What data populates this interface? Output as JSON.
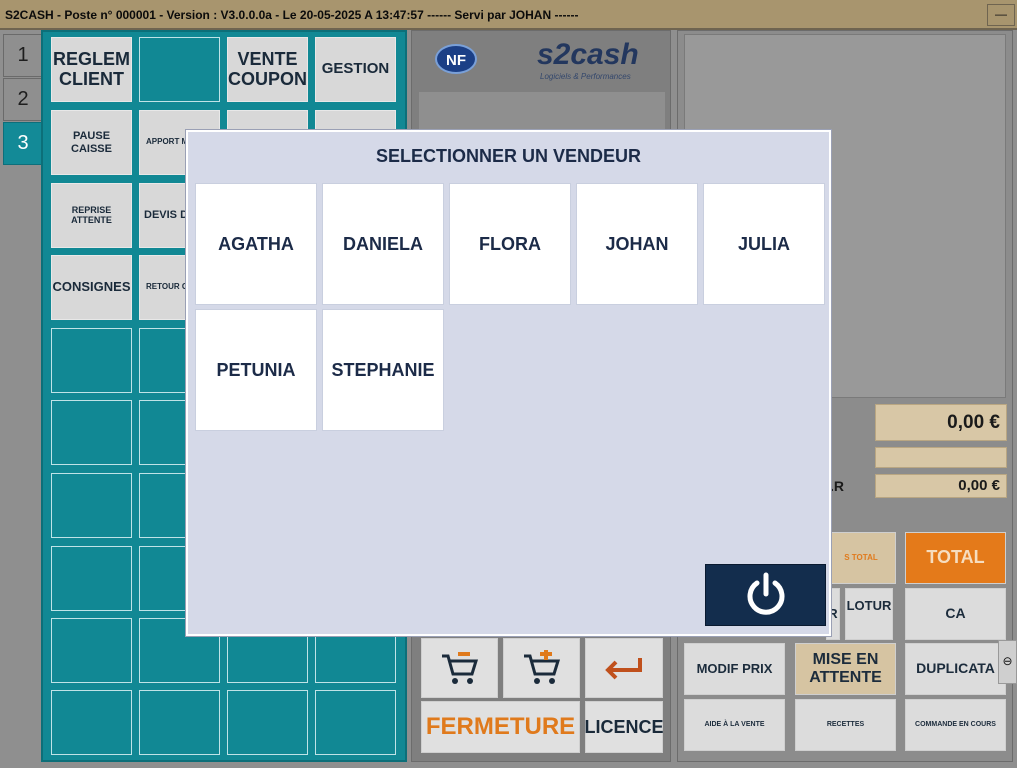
{
  "window": {
    "title": "S2CASH - Poste n° 000001 - Version : V3.0.0.0a - Le 20-05-2025 A 13:47:57 ------ Servi par JOHAN ------",
    "minimize_label": "—"
  },
  "tabs": [
    {
      "label": "1"
    },
    {
      "label": "2"
    },
    {
      "label": "3",
      "active": true
    }
  ],
  "grid": {
    "reglem_client": "REGLEM CLIENT",
    "vente_coupon": "VENTE COUPON",
    "gestion": "GESTION",
    "pause_caisse": "PAUSE CAISSE",
    "apport": "APPORT M",
    "reprise_attente": "REPRISE ATTENTE",
    "devis": "DEVIS DE",
    "consignes": "CONSIGNES",
    "retour": "RETOUR CO"
  },
  "logos": {
    "nf": "NF",
    "s2cash": "s2cash",
    "s2cash_sub": "Logiciels & Performances"
  },
  "middle": {
    "fermeture": "FERMETURE",
    "licence": "LICENCE"
  },
  "right": {
    "amount_total": "0,00 €",
    "amount_secondary": "0,00 €",
    "label_partial": ".R",
    "total": "TOTAL",
    "cloture": "LOTUR",
    "cloture_left": "R",
    "ca": "CA",
    "modif_prix": "MODIF PRIX",
    "mise_en_attente": "MISE EN ATTENTE",
    "duplicata": "DUPLICATA",
    "commande_en_cours": "COMMANDE EN COURS",
    "aide_vente": "AIDE À LA VENTE",
    "recettes": "RECETTES",
    "sous_total": "S TOTAL"
  },
  "modal": {
    "title": "SELECTIONNER UN VENDEUR",
    "vendors": [
      "AGATHA",
      "DANIELA",
      "FLORA",
      "JOHAN",
      "JULIA",
      "PETUNIA",
      "STEPHANIE"
    ]
  },
  "colors": {
    "teal_panel": "#118894",
    "modal_bg": "#d5d9e8",
    "vendor_text": "#1c2b48",
    "power_button": "#132d4d",
    "fermeture_text": "#e07a1c",
    "total_button": "#e47a1a"
  }
}
